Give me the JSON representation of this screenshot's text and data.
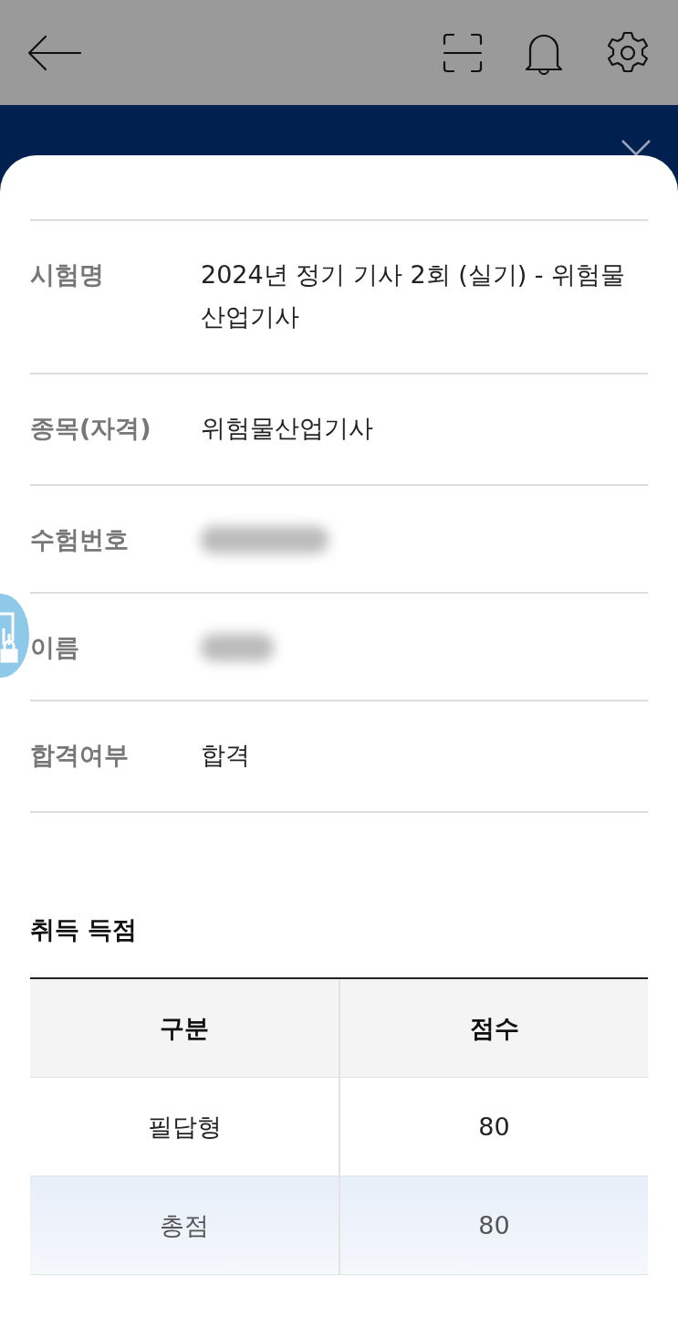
{
  "details": [
    {
      "label": "시험명",
      "value": "2024년 정기 기사 2회 (실기) - 위험물산업기사",
      "blurred": false
    },
    {
      "label": "종목(자격)",
      "value": "위험물산업기사",
      "blurred": false
    },
    {
      "label": "수험번호",
      "blurred": true
    },
    {
      "label": "이름",
      "blurred": true
    },
    {
      "label": "합격여부",
      "value": "합격",
      "blurred": false
    }
  ],
  "score_section": {
    "title": "취득 득점",
    "columns": [
      "구분",
      "점수"
    ],
    "rows": [
      {
        "kind": "item",
        "cells": [
          "필답형",
          "80"
        ]
      },
      {
        "kind": "total",
        "cells": [
          "총점",
          "80"
        ]
      }
    ]
  }
}
